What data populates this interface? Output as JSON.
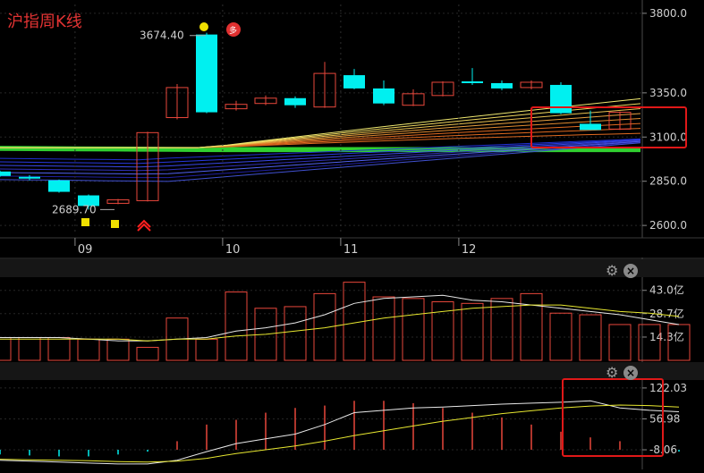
{
  "title": "沪指周K线",
  "chart_data": [
    {
      "type": "candlestick",
      "ylim": [
        2550,
        3850
      ],
      "y_ticks": [
        "3800.0",
        "3350.0",
        "3100.0",
        "2850.0",
        "2600.0"
      ],
      "x_ticks": [
        {
          "label": "09",
          "index": 2
        },
        {
          "label": "10",
          "index": 7
        },
        {
          "label": "11",
          "index": 11
        },
        {
          "label": "12",
          "index": 15
        }
      ],
      "annotations": {
        "high": "3674.40",
        "low": "2689.70",
        "signal": "多"
      },
      "candles": [
        {
          "o": 2905,
          "c": 2880,
          "h": 2910,
          "l": 2875
        },
        {
          "o": 2875,
          "c": 2865,
          "h": 2885,
          "l": 2855
        },
        {
          "o": 2855,
          "c": 2790,
          "h": 2860,
          "l": 2785
        },
        {
          "o": 2770,
          "c": 2710,
          "h": 2775,
          "l": 2689.7
        },
        {
          "o": 2725,
          "c": 2745,
          "h": 2750,
          "l": 2720
        },
        {
          "o": 2740,
          "c": 3125,
          "h": 3130,
          "l": 2735
        },
        {
          "o": 3210,
          "c": 3380,
          "h": 3400,
          "l": 3200
        },
        {
          "o": 3680,
          "c": 3240,
          "h": 3690,
          "l": 3235
        },
        {
          "o": 3260,
          "c": 3285,
          "h": 3305,
          "l": 3250
        },
        {
          "o": 3290,
          "c": 3320,
          "h": 3335,
          "l": 3280
        },
        {
          "o": 3320,
          "c": 3280,
          "h": 3330,
          "l": 3265
        },
        {
          "o": 3270,
          "c": 3460,
          "h": 3525,
          "l": 3265
        },
        {
          "o": 3450,
          "c": 3375,
          "h": 3485,
          "l": 3370
        },
        {
          "o": 3375,
          "c": 3290,
          "h": 3420,
          "l": 3280
        },
        {
          "o": 3280,
          "c": 3345,
          "h": 3370,
          "l": 3275
        },
        {
          "o": 3335,
          "c": 3410,
          "h": 3415,
          "l": 3330
        },
        {
          "o": 3415,
          "c": 3405,
          "h": 3490,
          "l": 3395
        },
        {
          "o": 3405,
          "c": 3375,
          "h": 3420,
          "l": 3365
        },
        {
          "o": 3380,
          "c": 3410,
          "h": 3420,
          "l": 3370
        },
        {
          "o": 3395,
          "c": 3235,
          "h": 3410,
          "l": 3230
        },
        {
          "o": 3175,
          "c": 3140,
          "h": 3250,
          "l": 3140
        },
        {
          "o": 3145,
          "c": 3240,
          "h": 3245,
          "l": 3140
        }
      ]
    },
    {
      "type": "bar",
      "ylim": [
        0,
        50
      ],
      "y_ticks": [
        "43.0亿",
        "28.7亿",
        "14.3亿"
      ],
      "values": [
        14,
        14,
        14,
        13,
        13,
        8,
        26,
        13,
        42,
        32,
        33,
        41,
        48,
        39,
        38,
        36,
        35,
        38,
        41,
        29,
        28,
        22,
        22,
        22
      ]
    },
    {
      "type": "bar",
      "ylim": [
        -40,
        135
      ],
      "y_ticks": [
        "122.03",
        "56.98",
        "-8.06"
      ],
      "values": [
        -18,
        -20,
        -22,
        -22,
        -18,
        -12,
        10,
        45,
        55,
        70,
        80,
        85,
        95,
        95,
        90,
        80,
        70,
        60,
        45,
        30,
        18,
        10,
        -8,
        -12
      ]
    }
  ]
}
